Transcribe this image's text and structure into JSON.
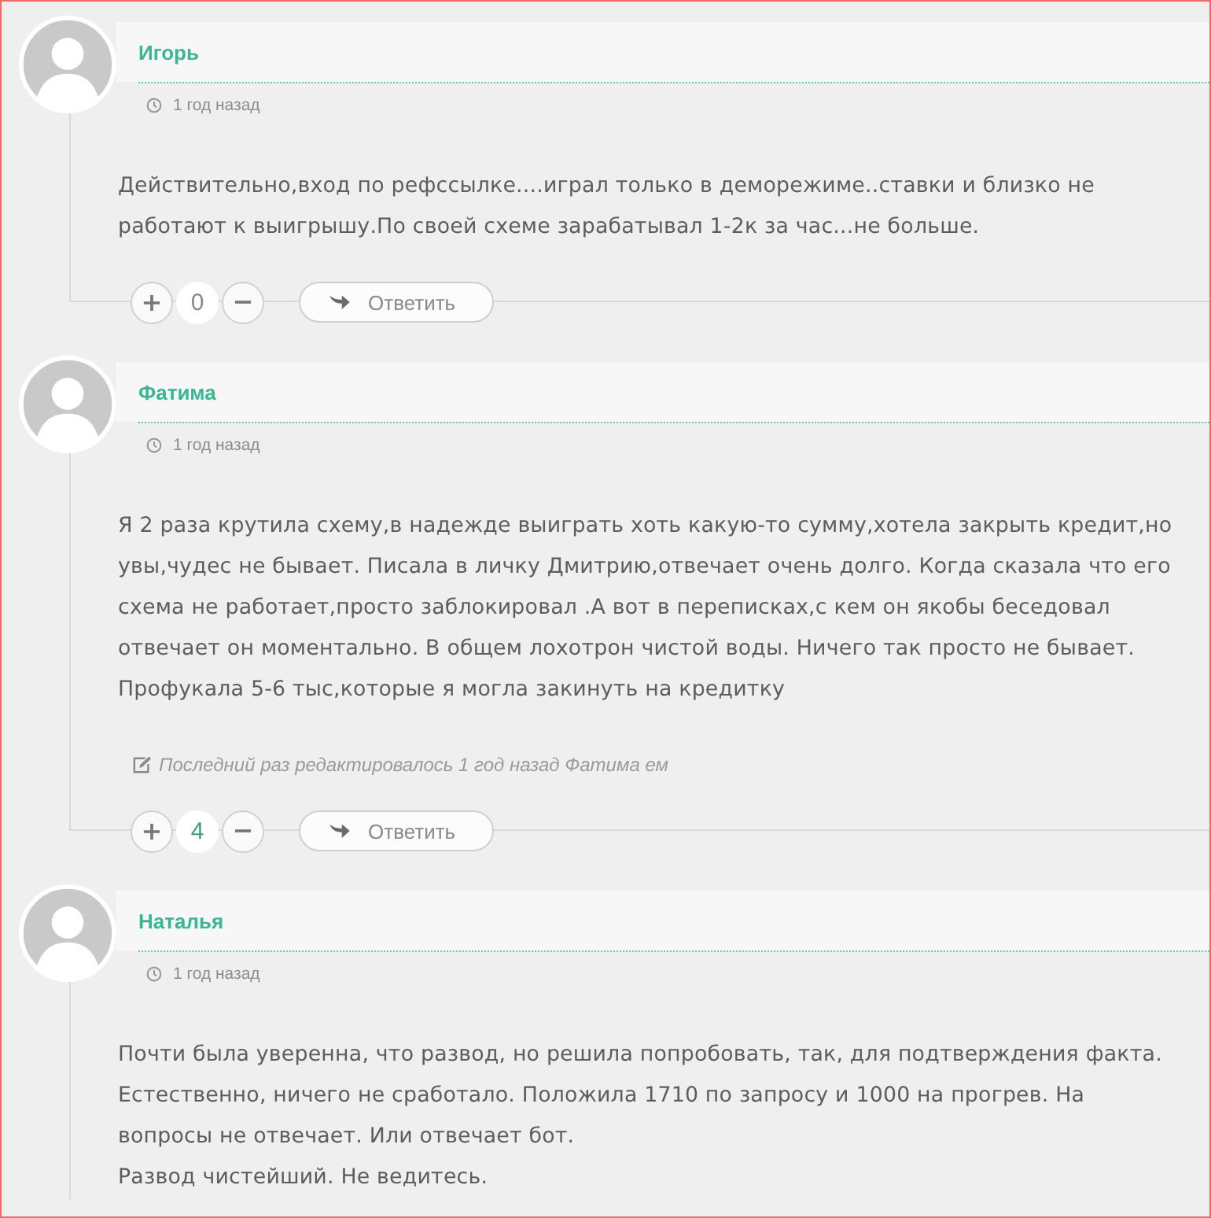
{
  "comments": [
    {
      "author": "Игорь",
      "time": "1 год назад",
      "body": [
        "Действительно,вход по рефссылке....играл только в деморежиме..ставки и близко не работают к выигрышу.По своей схеме зарабатывал 1-2к за час...не больше."
      ],
      "votes": {
        "count": "0",
        "positive": false
      },
      "reply_label": "Ответить"
    },
    {
      "author": "Фатима",
      "time": "1 год назад",
      "body": [
        "Я 2 раза крутила схему,в надежде выиграть хоть какую-то сумму,хотела закрыть кредит,но увы,чудес не бывает. Писала в личку Дмитрию,отвечает очень долго. Когда сказала что его схема не работает,просто заблокировал .А вот в переписках,с кем он якобы беседовал отвечает он моментально. В общем лохотрон чистой воды. Ничего так просто не бывает. Профукала 5-6 тыс,которые я могла закинуть на кредитку"
      ],
      "edited_note": "Последний раз редактировалось 1 год назад Фатима ем",
      "votes": {
        "count": "4",
        "positive": true
      },
      "reply_label": "Ответить"
    },
    {
      "author": "Наталья",
      "time": "1 год назад",
      "body": [
        "Почти была уверенна, что развод, но решила попробовать, так, для подтверждения факта. Естественно, ничего не сработало. Положила 1710 по запросу и 1000 на прогрев. На вопросы не отвечает. Или отвечает бот.",
        "Развод чистейший. Не ведитесь."
      ]
    }
  ]
}
